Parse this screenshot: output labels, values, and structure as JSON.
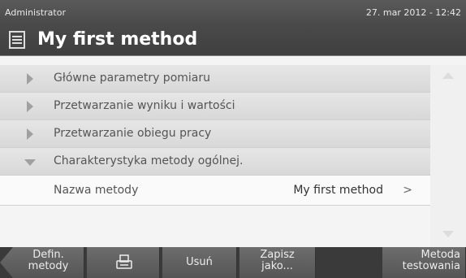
{
  "status": {
    "user": "Administrator",
    "datetime": "27. mar 2012 - 12:42"
  },
  "header": {
    "title": "My first method",
    "icon": "method-list-icon"
  },
  "sections": [
    {
      "label": "Główne parametry pomiaru",
      "expanded": false
    },
    {
      "label": "Przetwarzanie wyniku i wartości",
      "expanded": false
    },
    {
      "label": "Przetwarzanie obiegu pracy",
      "expanded": false
    },
    {
      "label": "Charakterystyka metody ogólnej.",
      "expanded": true
    }
  ],
  "fields": [
    {
      "label": "Nazwa metody",
      "value": "My first method",
      "chevron": ">"
    }
  ],
  "toolbar": {
    "back_line1": "Defin.",
    "back_line2": "metody",
    "print_icon": "printer-icon",
    "delete_label": "Usuń",
    "save_line1": "Zapisz",
    "save_line2": "jako...",
    "test_line1": "Metoda",
    "test_line2": "testowania"
  },
  "colors": {
    "header_bg": "#444444",
    "row_bg": "#dcdcdc",
    "toolbar_btn": "#5e5e5e"
  }
}
